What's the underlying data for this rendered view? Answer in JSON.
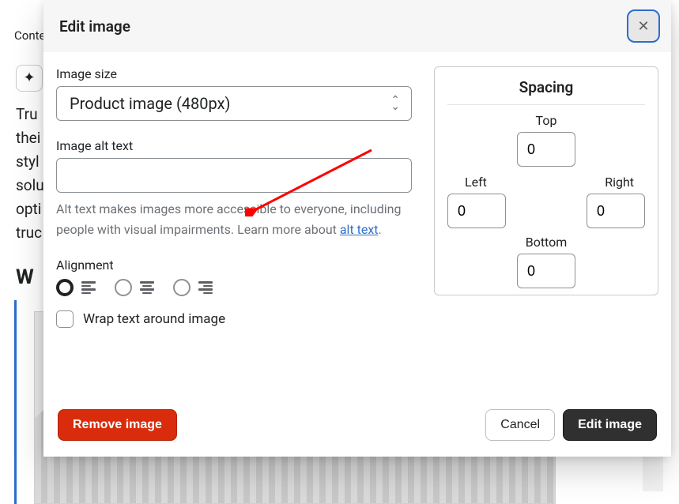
{
  "bg": {
    "conte": "Conte",
    "lines": "Tru\nthei\nstyl\nsolu\nopti\ntruc",
    "w": "W"
  },
  "modal": {
    "title": "Edit image",
    "close_aria": "Close"
  },
  "image_size": {
    "label": "Image size",
    "value": "Product image (480px)"
  },
  "alt_text": {
    "label": "Image alt text",
    "value": "",
    "help_pre": "Alt text makes images more accessible to everyone, including people with visual impairments. Learn more about ",
    "help_link": "alt text",
    "help_post": "."
  },
  "alignment": {
    "label": "Alignment",
    "selected": "left",
    "wrap_label": "Wrap text around image",
    "wrap_checked": false
  },
  "spacing": {
    "title": "Spacing",
    "top_label": "Top",
    "left_label": "Left",
    "right_label": "Right",
    "bottom_label": "Bottom",
    "top": "0",
    "left": "0",
    "right": "0",
    "bottom": "0"
  },
  "footer": {
    "remove": "Remove image",
    "cancel": "Cancel",
    "submit": "Edit image"
  }
}
